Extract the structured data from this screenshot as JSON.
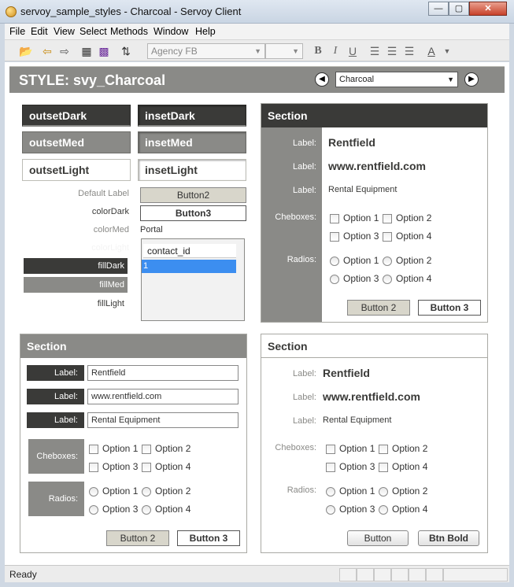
{
  "window": {
    "title": "servoy_sample_styles - Charcoal - Servoy Client",
    "minimize": "—",
    "maximize": "▢",
    "close": "✕"
  },
  "menu": [
    "File",
    "Edit",
    "View",
    "Select",
    "Methods",
    "Window",
    "Help"
  ],
  "toolbar": {
    "font_name": "Agency FB",
    "font_size": "",
    "bold": "B",
    "italic": "I",
    "underline": "U",
    "text_color": "A"
  },
  "header": {
    "title": "STYLE: svy_Charcoal",
    "prev": "◀",
    "next": "▶",
    "selected_style": "Charcoal"
  },
  "styles": {
    "outset_dark": "outsetDark",
    "outset_med": "outsetMed",
    "outset_light": "outsetLight",
    "inset_dark": "insetDark",
    "inset_med": "insetMed",
    "inset_light": "insetLight",
    "default_label": "Default Label",
    "color_dark": "colorDark",
    "color_med": "colorMed",
    "color_light": "colorLight",
    "fill_dark": "fillDark",
    "fill_med": "fillMed",
    "fill_light": "fillLight",
    "button2": "Button2",
    "button3": "Button3",
    "portal": "Portal",
    "portal_header": "contact_id",
    "portal_row": "1"
  },
  "section1": {
    "title": "Section",
    "label1": "Label:",
    "value1": "Rentfield",
    "label2": "Label:",
    "value2": "www.rentfield.com",
    "label3": "Label:",
    "value3": "Rental Equipment",
    "checkboxes_label": "Cheboxes:",
    "radios_label": "Radios:",
    "options": [
      "Option 1",
      "Option 2",
      "Option 3",
      "Option 4"
    ],
    "button_a": "Button 2",
    "button_b": "Button 3"
  },
  "section2": {
    "title": "Section",
    "label1": "Label:",
    "value1": "Rentfield",
    "label2": "Label:",
    "value2": "www.rentfield.com",
    "label3": "Label:",
    "value3": "Rental Equipment",
    "checkboxes_label": "Cheboxes:",
    "radios_label": "Radios:",
    "options": [
      "Option 1",
      "Option 2",
      "Option 3",
      "Option 4"
    ],
    "button_a": "Button 2",
    "button_b": "Button 3"
  },
  "section3": {
    "title": "Section",
    "label1": "Label:",
    "value1": "Rentfield",
    "label2": "Label:",
    "value2": "www.rentfield.com",
    "label3": "Label:",
    "value3": "Rental Equipment",
    "checkboxes_label": "Cheboxes:",
    "radios_label": "Radios:",
    "options": [
      "Option 1",
      "Option 2",
      "Option 3",
      "Option 4"
    ],
    "button_a": "Button",
    "button_b": "Btn Bold"
  },
  "status": {
    "text": "Ready"
  },
  "colors": {
    "dark": "#3a3a38",
    "med": "#8a8a87",
    "light": "#ffffff",
    "selection": "#3c8ef0"
  }
}
